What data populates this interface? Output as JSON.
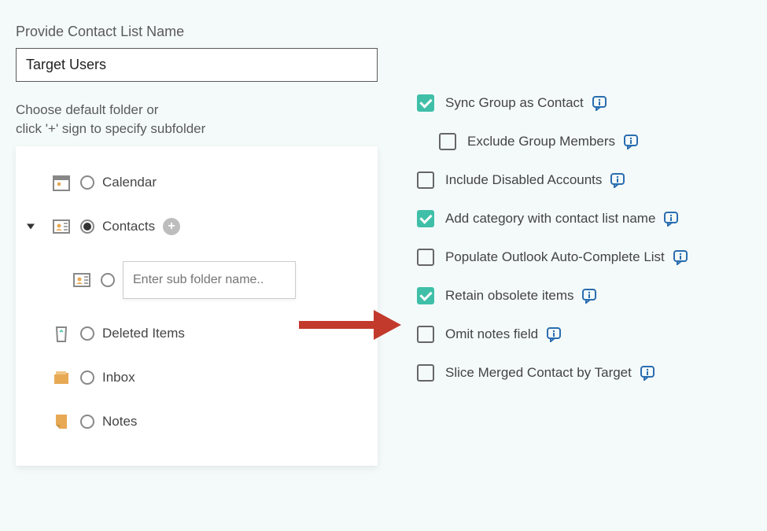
{
  "nameSection": {
    "label": "Provide Contact List Name",
    "value": "Target Users"
  },
  "folderSection": {
    "labelLine1": "Choose default folder or",
    "labelLine2": "click '+' sign to specify subfolder",
    "subfolderPlaceholder": "Enter sub folder name..",
    "items": {
      "calendar": "Calendar",
      "contacts": "Contacts",
      "deleted": "Deleted Items",
      "inbox": "Inbox",
      "notes": "Notes"
    }
  },
  "options": {
    "syncGroup": {
      "label": "Sync Group as Contact",
      "checked": true
    },
    "excludeGroup": {
      "label": "Exclude Group Members",
      "checked": false
    },
    "includeDisabled": {
      "label": "Include Disabled Accounts",
      "checked": false
    },
    "addCategory": {
      "label": "Add category with contact list name",
      "checked": true
    },
    "populateOutlook": {
      "label": "Populate Outlook Auto-Complete List",
      "checked": false
    },
    "retainObsolete": {
      "label": "Retain obsolete items",
      "checked": true
    },
    "omitNotes": {
      "label": "Omit notes field",
      "checked": false
    },
    "sliceMerged": {
      "label": "Slice Merged Contact by Target",
      "checked": false
    }
  }
}
